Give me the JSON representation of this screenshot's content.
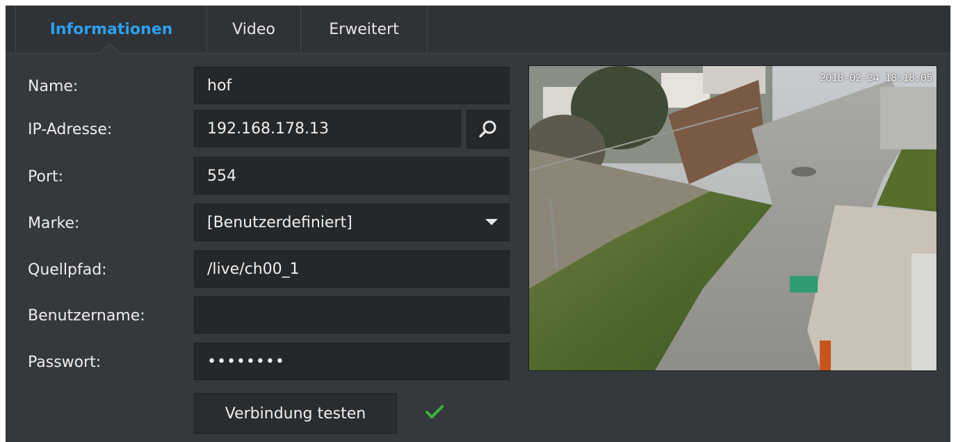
{
  "tabs": [
    {
      "label": "Informationen",
      "active": true
    },
    {
      "label": "Video",
      "active": false
    },
    {
      "label": "Erweitert",
      "active": false
    }
  ],
  "form": {
    "name": {
      "label": "Name:",
      "value": "hof"
    },
    "ip": {
      "label": "IP-Adresse:",
      "value": "192.168.178.13"
    },
    "port": {
      "label": "Port:",
      "value": "554"
    },
    "brand": {
      "label": "Marke:",
      "value": "[Benutzerdefiniert]"
    },
    "source_path": {
      "label": "Quellpfad:",
      "value": "/live/ch00_1"
    },
    "username": {
      "label": "Benutzername:",
      "value": ""
    },
    "password": {
      "label": "Passwort:",
      "value": "••••••••"
    }
  },
  "test_button_label": "Verbindung testen",
  "test_status": "success",
  "preview": {
    "timestamp": "2018-02-24 18:18:05"
  },
  "icons": {
    "search": "search-icon",
    "dropdown": "chevron-down-icon",
    "check": "check-icon"
  },
  "colors": {
    "accent": "#2e9ff0",
    "success": "#3cb43c",
    "panel": "#35393d",
    "field": "#25282b"
  }
}
